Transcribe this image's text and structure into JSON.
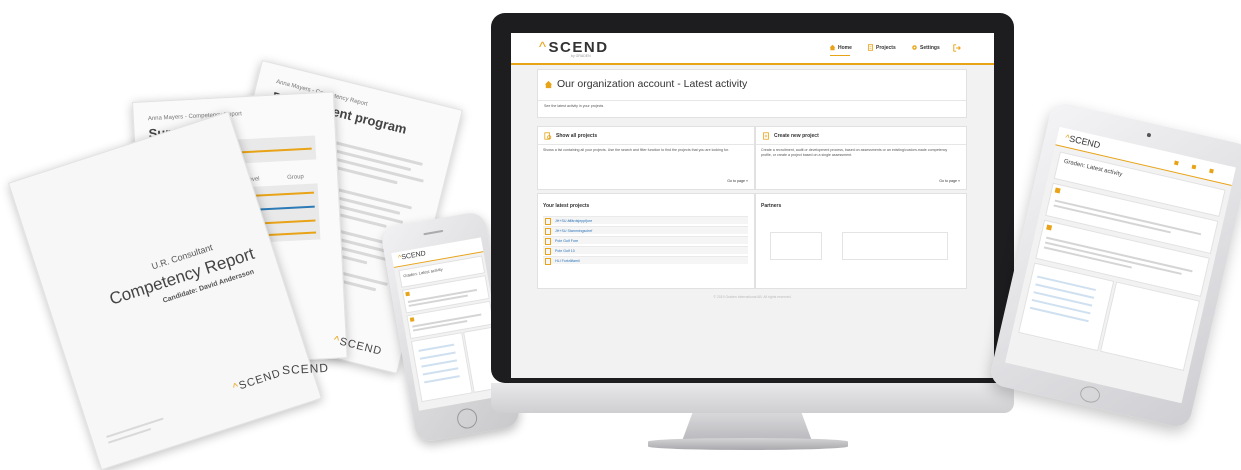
{
  "documents": {
    "back": {
      "header": "Anna Mayers - Competency Report",
      "title": "Development program"
    },
    "middle": {
      "header": "Anna Mayers - Competency Report",
      "title": "Summary",
      "col1": "Level",
      "col2": "Group"
    },
    "front": {
      "subtitle": "U.R. Consultant",
      "title": "Competency Report",
      "candidate": "Candidate: David Andersson",
      "logo": "SCEND"
    },
    "stack_logo": "SCEND"
  },
  "desktop": {
    "brand": {
      "name": "SCEND",
      "caret": "^",
      "sub": "by GRADEN"
    },
    "nav": [
      {
        "label": "Home",
        "icon": "home-icon",
        "active": true
      },
      {
        "label": "Projects",
        "icon": "document-icon",
        "active": false
      },
      {
        "label": "Settings",
        "icon": "gear-icon",
        "active": false
      }
    ],
    "logout_icon": "logout-icon",
    "page": {
      "title": "Our organization account - Latest activity",
      "subtitle": "See the latest activity in your projects"
    },
    "cards": {
      "show_all": {
        "title": "Show all projects",
        "text": "Shows a list containing all your projects. Use the search and filter function to find the projects that you are looking for.",
        "link": "Go to page »"
      },
      "create": {
        "title": "Create new project",
        "text": "Create a recruitment, audit or development process, based on assessments or an existing/custom-made competency profile, or create a project based on a single assessment.",
        "link": "Go to page »"
      }
    },
    "latest_projects": {
      "title": "Your latest projects",
      "items": [
        "JH+SU äffärdsjeppfjore",
        "JH+SU Stammingschef",
        "Pole Golf Fore",
        "Pole Golf 10",
        "HLI Forkråfamil"
      ]
    },
    "partners": {
      "title": "Partners"
    },
    "footer": "© 2019 Graden International AB. All rights reserved."
  },
  "phone": {
    "brand": "SCEND",
    "heading": "Graden: Latest activity"
  },
  "tablet": {
    "brand": "SCEND",
    "heading": "Graden: Latest activity"
  },
  "colors": {
    "accent": "#e8a317",
    "link": "#2a73b8",
    "frame": "#1d1d1f"
  }
}
